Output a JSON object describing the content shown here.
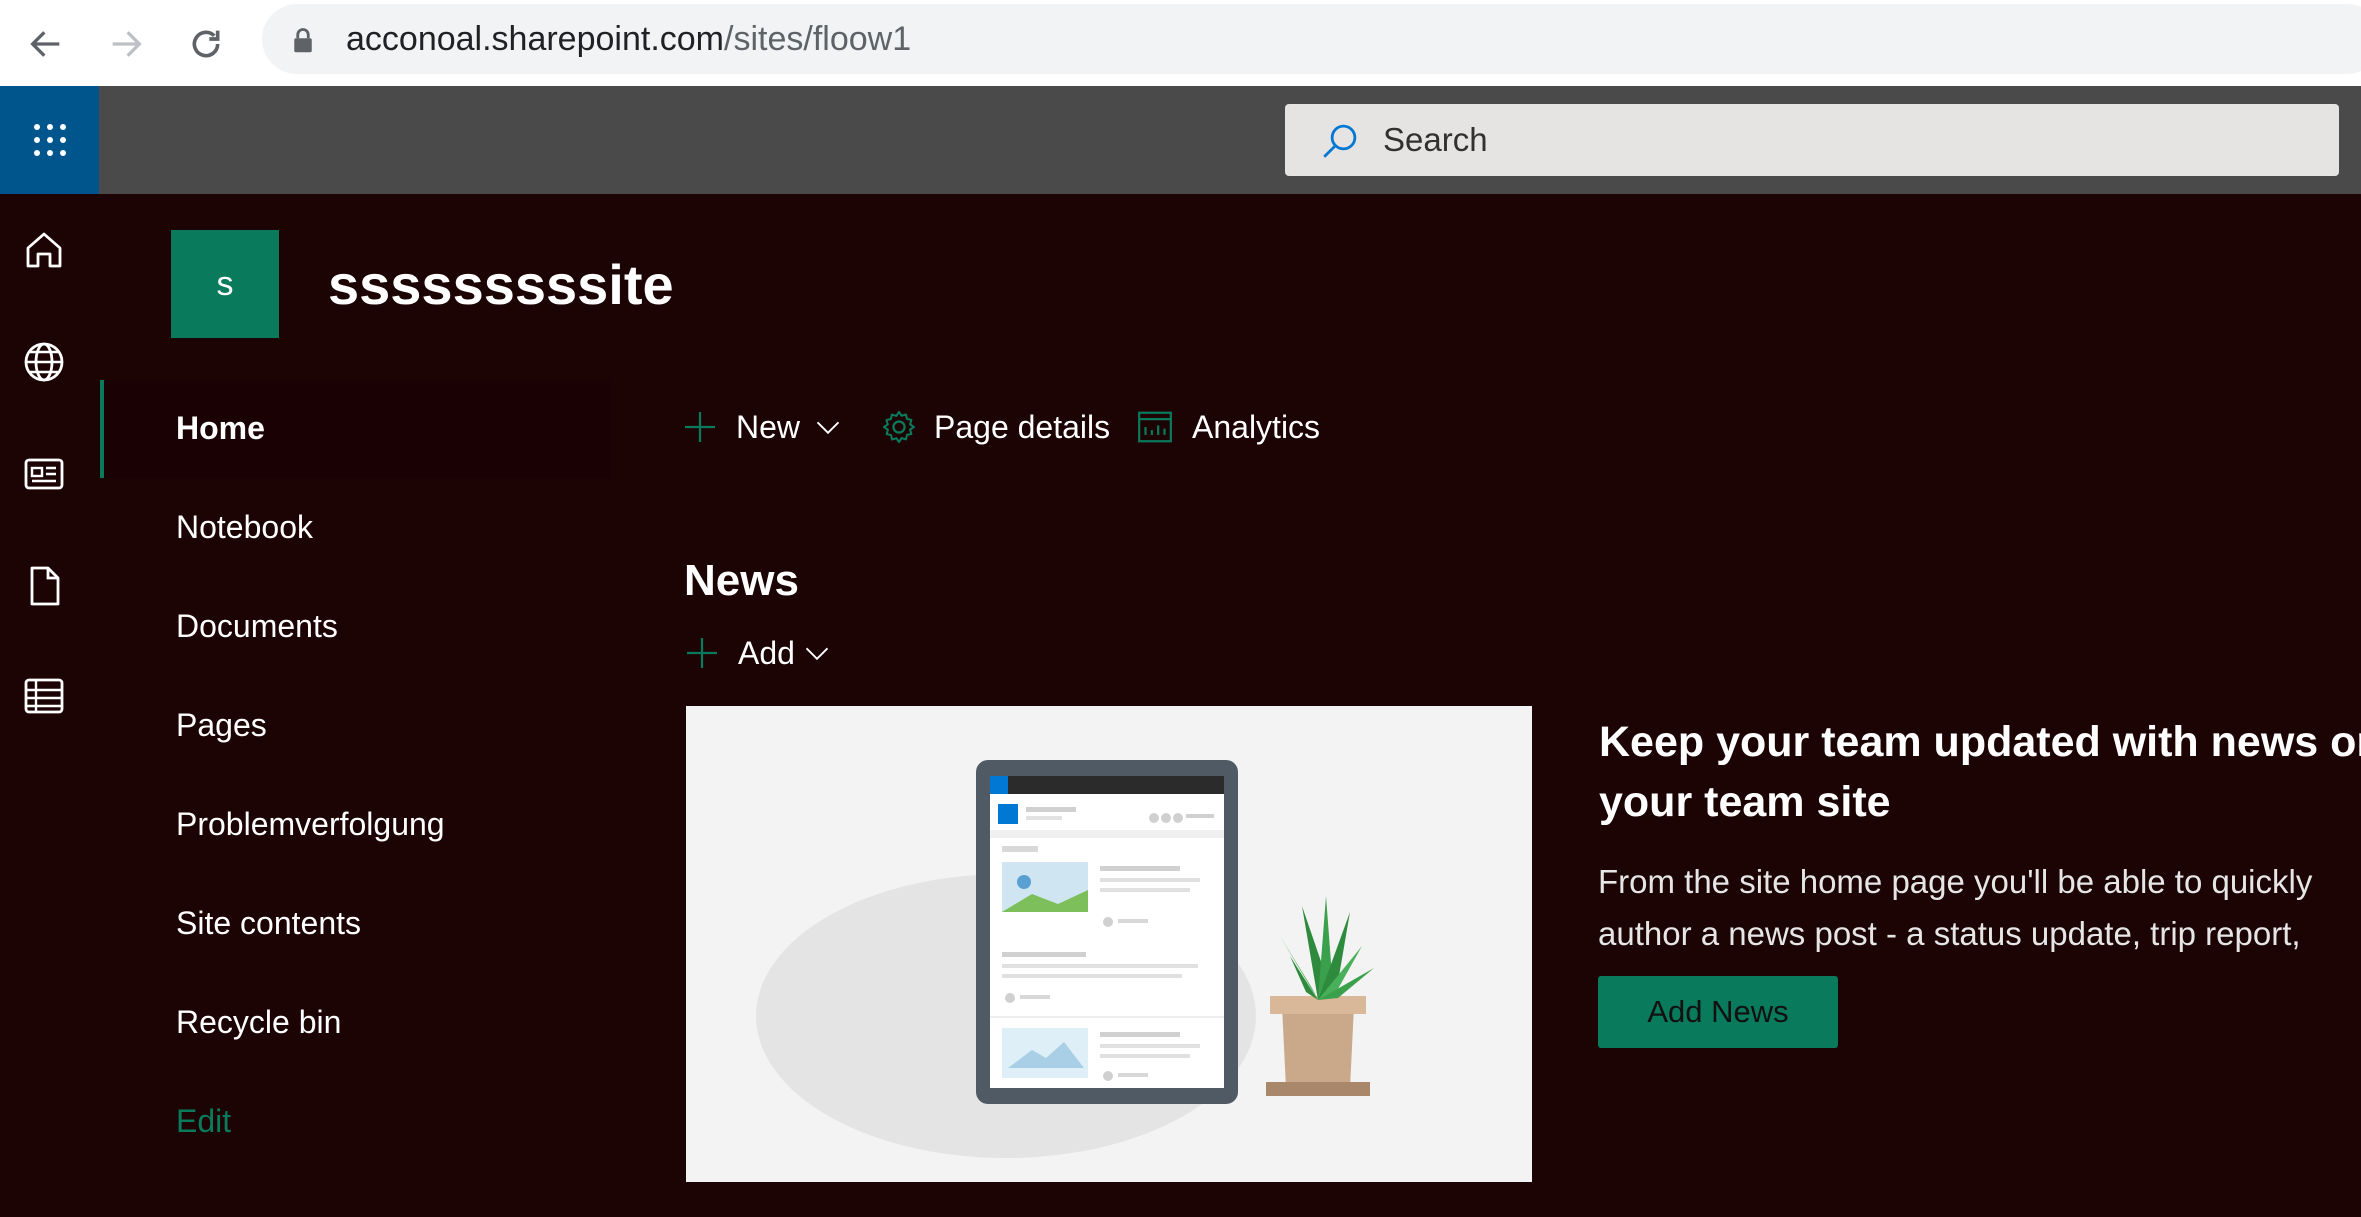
{
  "browser": {
    "url_host": "acconoal.sharepoint.com",
    "url_path": "/sites/floow1"
  },
  "suite": {
    "search_placeholder": "Search"
  },
  "site": {
    "logo_letter": "s",
    "title": "sssssssssite"
  },
  "nav": {
    "items": [
      {
        "label": "Home"
      },
      {
        "label": "Notebook"
      },
      {
        "label": "Documents"
      },
      {
        "label": "Pages"
      },
      {
        "label": "Problemverfolgung"
      },
      {
        "label": "Site contents"
      },
      {
        "label": "Recycle bin"
      },
      {
        "label": "Edit"
      }
    ]
  },
  "commandbar": {
    "new_label": "New",
    "page_details_label": "Page details",
    "analytics_label": "Analytics"
  },
  "news": {
    "title": "News",
    "add_label": "Add",
    "promo_title_line1": "Keep your team updated with news on",
    "promo_title_line2": "your team site",
    "promo_body_line1": "From the site home page you'll be able to quickly",
    "promo_body_line2": "author a news post - a status update, trip report,",
    "add_news_label": "Add News"
  },
  "colors": {
    "accent": "#0a7a5c",
    "page_background": "#1c0304",
    "suite_bar": "#4a4a4a",
    "waffle": "#00558c"
  }
}
